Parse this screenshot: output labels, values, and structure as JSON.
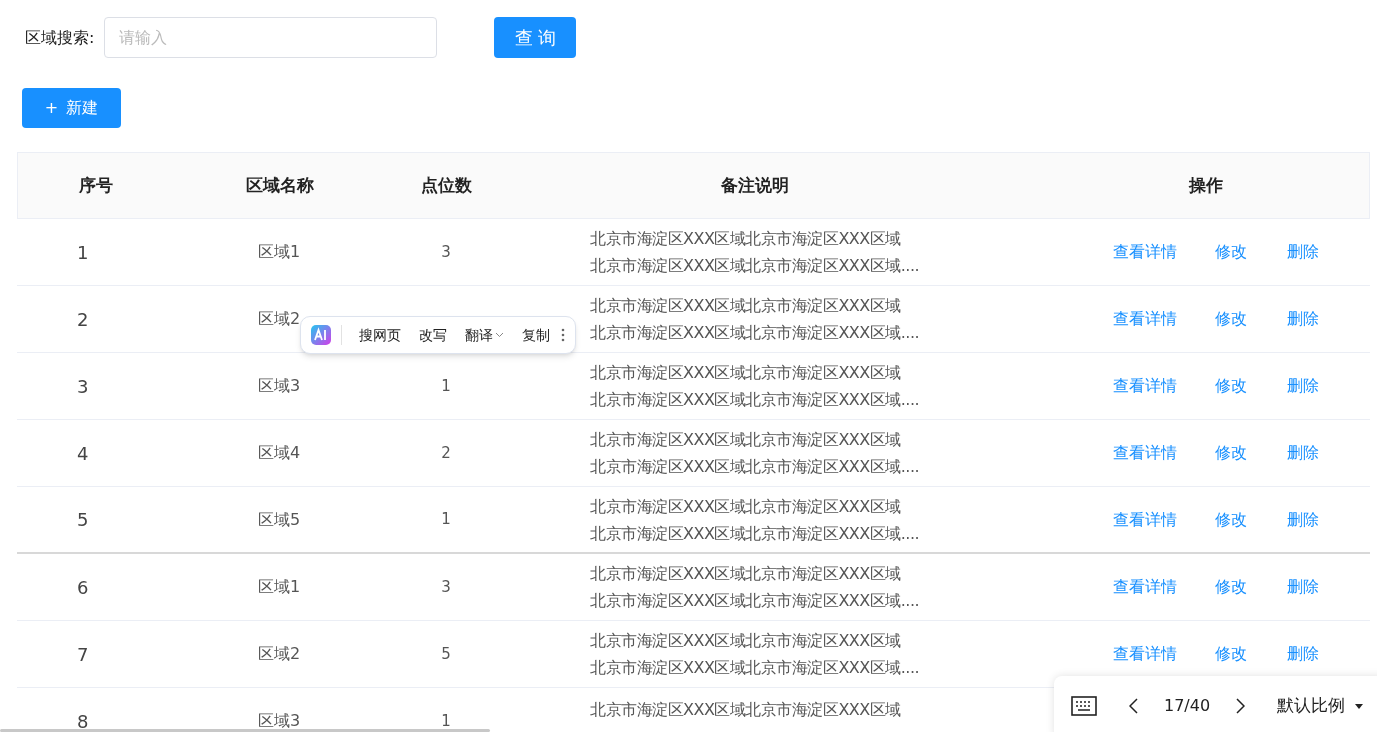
{
  "search": {
    "label": "区域搜索:",
    "placeholder": "请输入",
    "button": "查 询"
  },
  "new_button": {
    "icon": "+",
    "label": "新建"
  },
  "table": {
    "columns": [
      "序号",
      "区域名称",
      "点位数",
      "备注说明",
      "操作"
    ],
    "rows": [
      {
        "index": "1",
        "name": "区域1",
        "points": "3",
        "remark": [
          "北京市海淀区XXX区域北京市海淀区XXX区域",
          "北京市海淀区XXX区域北京市海淀区XXX区域...."
        ],
        "actions": [
          "查看详情",
          "修改",
          "删除"
        ]
      },
      {
        "index": "2",
        "name": "区域2",
        "remark": [
          "北京市海淀区XXX区域北京市海淀区XXX区域",
          "北京市海淀区XXX区域北京市海淀区XXX区域...."
        ],
        "actions": [
          "查看详情",
          "修改",
          "删除"
        ]
      },
      {
        "index": "3",
        "name": "区域3",
        "points": "1",
        "remark": [
          "北京市海淀区XXX区域北京市海淀区XXX区域",
          "北京市海淀区XXX区域北京市海淀区XXX区域...."
        ],
        "actions": [
          "查看详情",
          "修改",
          "删除"
        ]
      },
      {
        "index": "4",
        "name": "区域4",
        "points": "2",
        "remark": [
          "北京市海淀区XXX区域北京市海淀区XXX区域",
          "北京市海淀区XXX区域北京市海淀区XXX区域...."
        ],
        "actions": [
          "查看详情",
          "修改",
          "删除"
        ]
      },
      {
        "index": "5",
        "name": "区域5",
        "points": "1",
        "remark": [
          "北京市海淀区XXX区域北京市海淀区XXX区域",
          "北京市海淀区XXX区域北京市海淀区XXX区域...."
        ],
        "actions": [
          "查看详情",
          "修改",
          "删除"
        ]
      },
      {
        "index": "6",
        "name": "区域1",
        "points": "3",
        "remark": [
          "北京市海淀区XXX区域北京市海淀区XXX区域",
          "北京市海淀区XXX区域北京市海淀区XXX区域...."
        ],
        "actions": [
          "查看详情",
          "修改",
          "删除"
        ]
      },
      {
        "index": "7",
        "name": "区域2",
        "points": "5",
        "remark": [
          "北京市海淀区XXX区域北京市海淀区XXX区域",
          "北京市海淀区XXX区域北京市海淀区XXX区域...."
        ],
        "actions": [
          "查看详情",
          "修改",
          "删除"
        ]
      },
      {
        "index": "8",
        "name": "区域3",
        "points": "1",
        "remark": [
          "北京市海淀区XXX区域北京市海淀区XXX区域"
        ]
      }
    ]
  },
  "selection_popup": {
    "items": [
      {
        "label": "搜网页",
        "dropdown": false
      },
      {
        "label": "改写",
        "dropdown": false
      },
      {
        "label": "翻译",
        "dropdown": true
      },
      {
        "label": "复制",
        "dropdown": false
      }
    ]
  },
  "viewer_toolbar": {
    "page": "17/40",
    "zoom": "默认比例"
  }
}
